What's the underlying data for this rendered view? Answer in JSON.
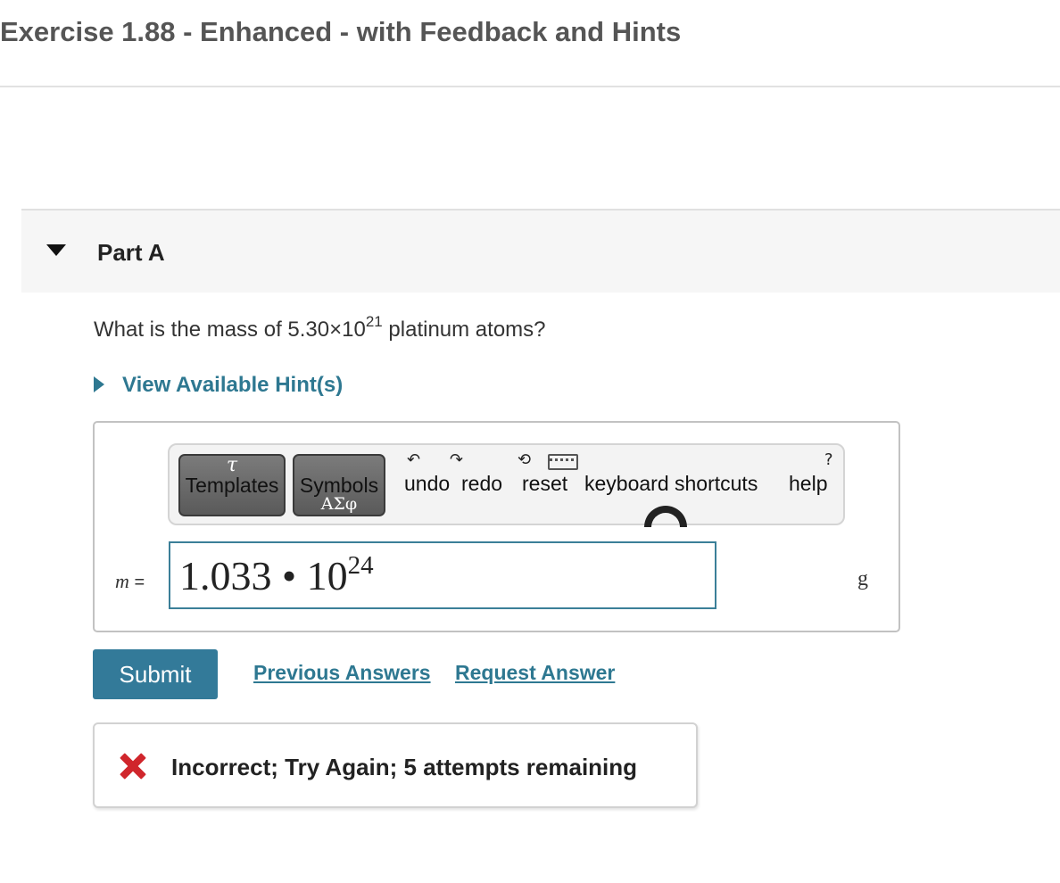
{
  "page": {
    "title": "Exercise 1.88 - Enhanced - with Feedback and Hints"
  },
  "part": {
    "label": "Part A",
    "expanded": true
  },
  "question": {
    "prefix": "What is the mass of 5.30×10",
    "exponent": "21",
    "suffix": " platinum atoms?"
  },
  "hints": {
    "label": "View Available Hint(s)"
  },
  "toolbar": {
    "templates": {
      "glyph": "τ",
      "label": "Templates"
    },
    "symbols": {
      "label": "Symbols",
      "glyph": "ΑΣφ"
    },
    "undo": "undo",
    "redo": "redo",
    "reset": "reset",
    "keyboard_shortcuts": "keyboard shortcuts",
    "help": "help"
  },
  "answer": {
    "variable": "m",
    "equals": "=",
    "mantissa": "1.033",
    "operator": "•",
    "base": "10",
    "exponent": "24",
    "unit": "g"
  },
  "actions": {
    "submit": "Submit",
    "previous_answers": "Previous Answers",
    "request_answer": "Request Answer"
  },
  "feedback": {
    "status": "incorrect",
    "message": "Incorrect; Try Again; 5 attempts remaining",
    "color": "#d0262c"
  },
  "colors": {
    "accent": "#2e7891",
    "button": "#337a99",
    "input_border": "#3b7f98"
  }
}
